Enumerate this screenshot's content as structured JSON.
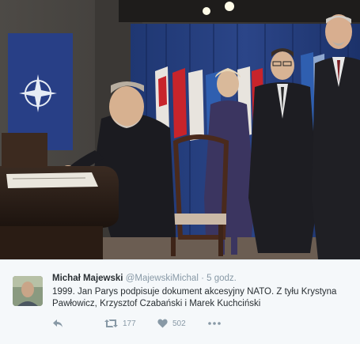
{
  "tweet": {
    "author_name": "Michał Majewski",
    "handle": "@MajewskiMichal",
    "separator": "·",
    "time": "5 godz.",
    "text_line1": "1999. Jan Parys podpisuje dokument akcesyjny NATO. Z tyłu Krystyna",
    "text_line2": "Pawłowicz, Krzysztof Czabański i Marek Kuchciński",
    "retweets": "177",
    "likes": "502"
  },
  "icons": {
    "reply": "reply-icon",
    "retweet": "retweet-icon",
    "like": "heart-icon",
    "more": "more-icon"
  },
  "colors": {
    "backdrop_blue": "#26407e",
    "footer_bg": "#f5f8fa",
    "text": "#292f33",
    "muted": "#8899a6"
  }
}
